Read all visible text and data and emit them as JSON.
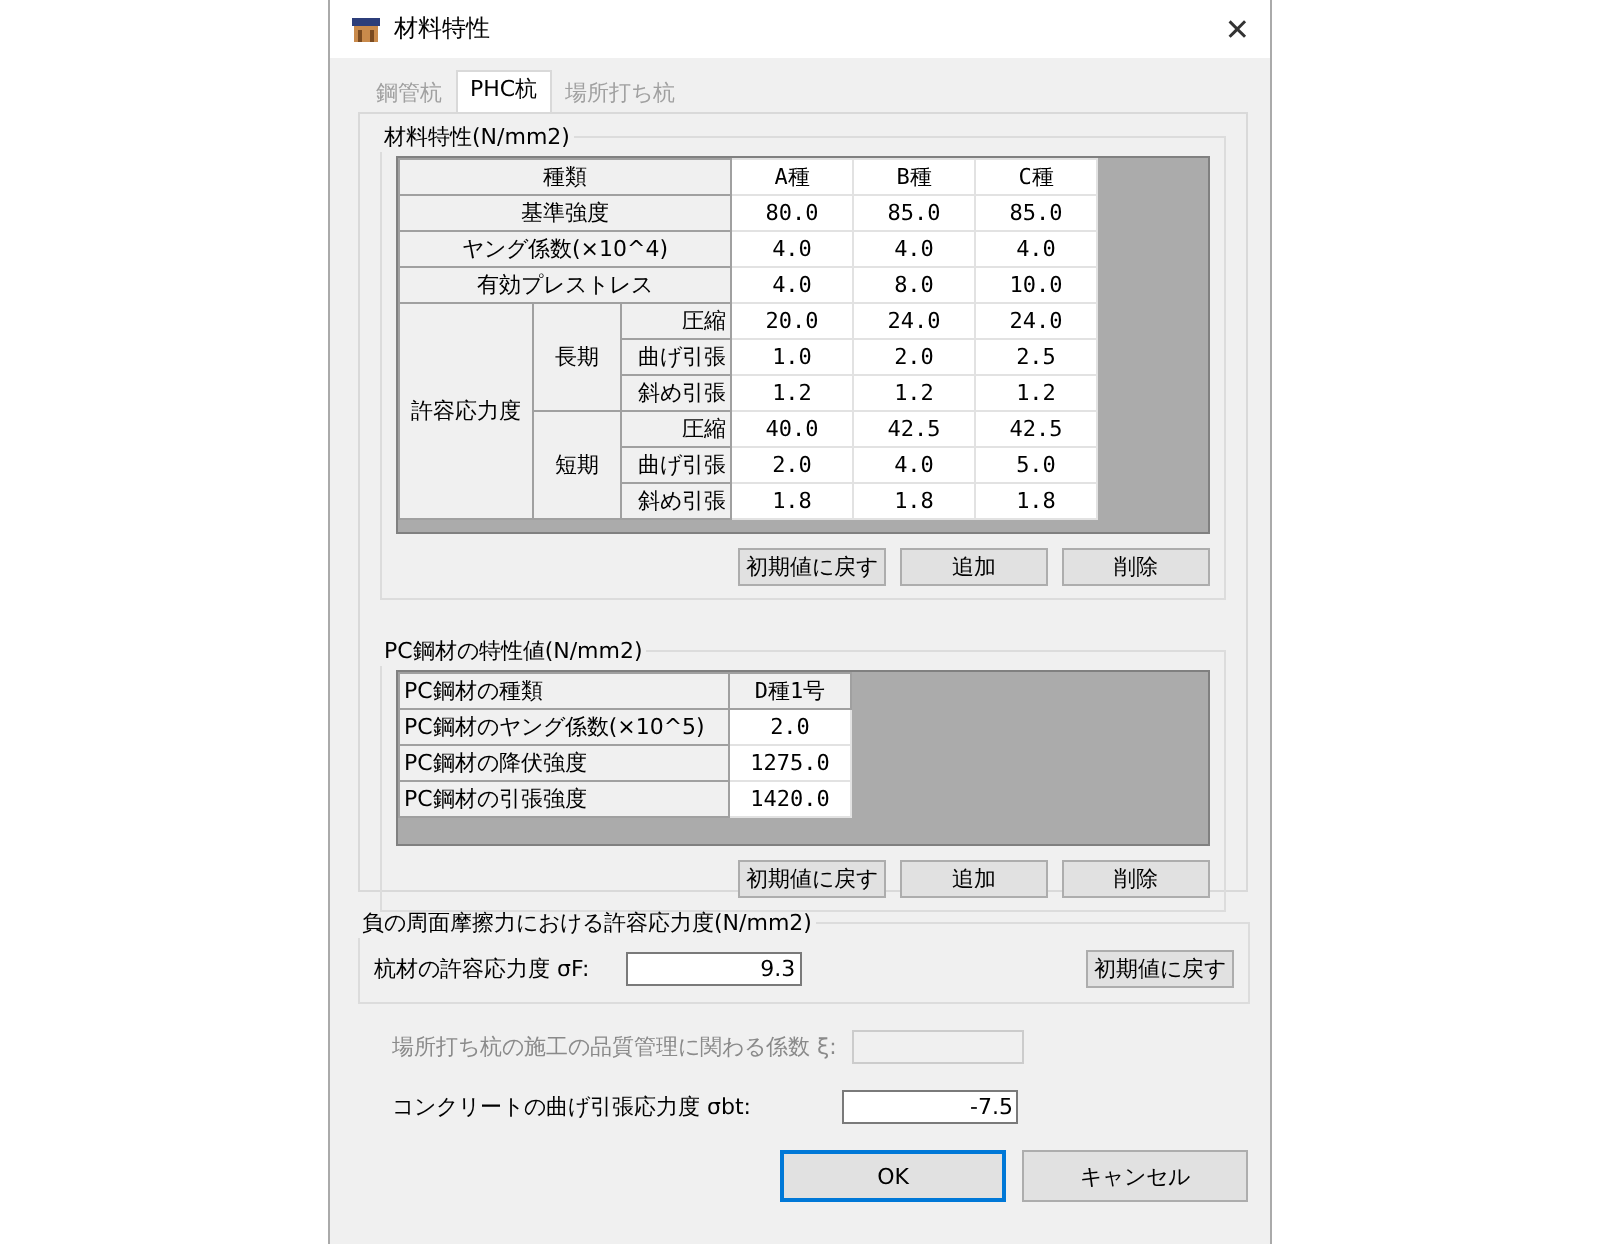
{
  "window": {
    "title": "材料特性",
    "close": "✕"
  },
  "tabs": [
    {
      "label": "鋼管杭",
      "selected": false,
      "disabled": true
    },
    {
      "label": "PHC杭",
      "selected": true,
      "disabled": false
    },
    {
      "label": "場所打ち杭",
      "selected": false,
      "disabled": true
    }
  ],
  "material_group": {
    "title": "材料特性(N/mm2)",
    "header_label": "種類",
    "columns": [
      "A種",
      "B種",
      "C種"
    ],
    "rows": [
      {
        "label": "基準強度",
        "values": [
          "80.0",
          "85.0",
          "85.0"
        ]
      },
      {
        "label": "ヤング係数(×10^4)",
        "values": [
          "4.0",
          "4.0",
          "4.0"
        ]
      },
      {
        "label": "有効プレストレス",
        "values": [
          "4.0",
          "8.0",
          "10.0"
        ]
      }
    ],
    "allowable": {
      "label": "許容応力度",
      "groups": [
        {
          "label": "長期",
          "rows": [
            {
              "label": "圧縮",
              "values": [
                "20.0",
                "24.0",
                "24.0"
              ]
            },
            {
              "label": "曲げ引張",
              "values": [
                "1.0",
                "2.0",
                "2.5"
              ]
            },
            {
              "label": "斜め引張",
              "values": [
                "1.2",
                "1.2",
                "1.2"
              ]
            }
          ]
        },
        {
          "label": "短期",
          "rows": [
            {
              "label": "圧縮",
              "values": [
                "40.0",
                "42.5",
                "42.5"
              ]
            },
            {
              "label": "曲げ引張",
              "values": [
                "2.0",
                "4.0",
                "5.0"
              ]
            },
            {
              "label": "斜め引張",
              "values": [
                "1.8",
                "1.8",
                "1.8"
              ]
            }
          ]
        }
      ]
    },
    "buttons": [
      "初期値に戻す",
      "追加",
      "削除"
    ]
  },
  "pc_group": {
    "title": "PC鋼材の特性値(N/mm2)",
    "rows": [
      {
        "label": "PC鋼材の種類",
        "value": "D種1号",
        "header": true
      },
      {
        "label": "PC鋼材のヤング係数(×10^5)",
        "value": "2.0",
        "header": false
      },
      {
        "label": "PC鋼材の降伏強度",
        "value": "1275.0",
        "header": false
      },
      {
        "label": "PC鋼材の引張強度",
        "value": "1420.0",
        "header": false
      }
    ],
    "buttons": [
      "初期値に戻す",
      "追加",
      "削除"
    ]
  },
  "friction_group": {
    "title": "負の周面摩擦力における許容応力度(N/mm2)",
    "label": "杭材の許容応力度 σF:",
    "value": "9.3",
    "button": "初期値に戻す"
  },
  "fields": [
    {
      "label": "場所打ち杭の施工の品質管理に関わる係数 ξ:",
      "disabled": true
    },
    {
      "label": "コンクリートの曲げ引張応力度 σbt:",
      "value": "-7.5",
      "disabled": false
    }
  ],
  "actions": [
    {
      "label": "OK",
      "default": true
    },
    {
      "label": "キャンセル",
      "default": false
    }
  ]
}
